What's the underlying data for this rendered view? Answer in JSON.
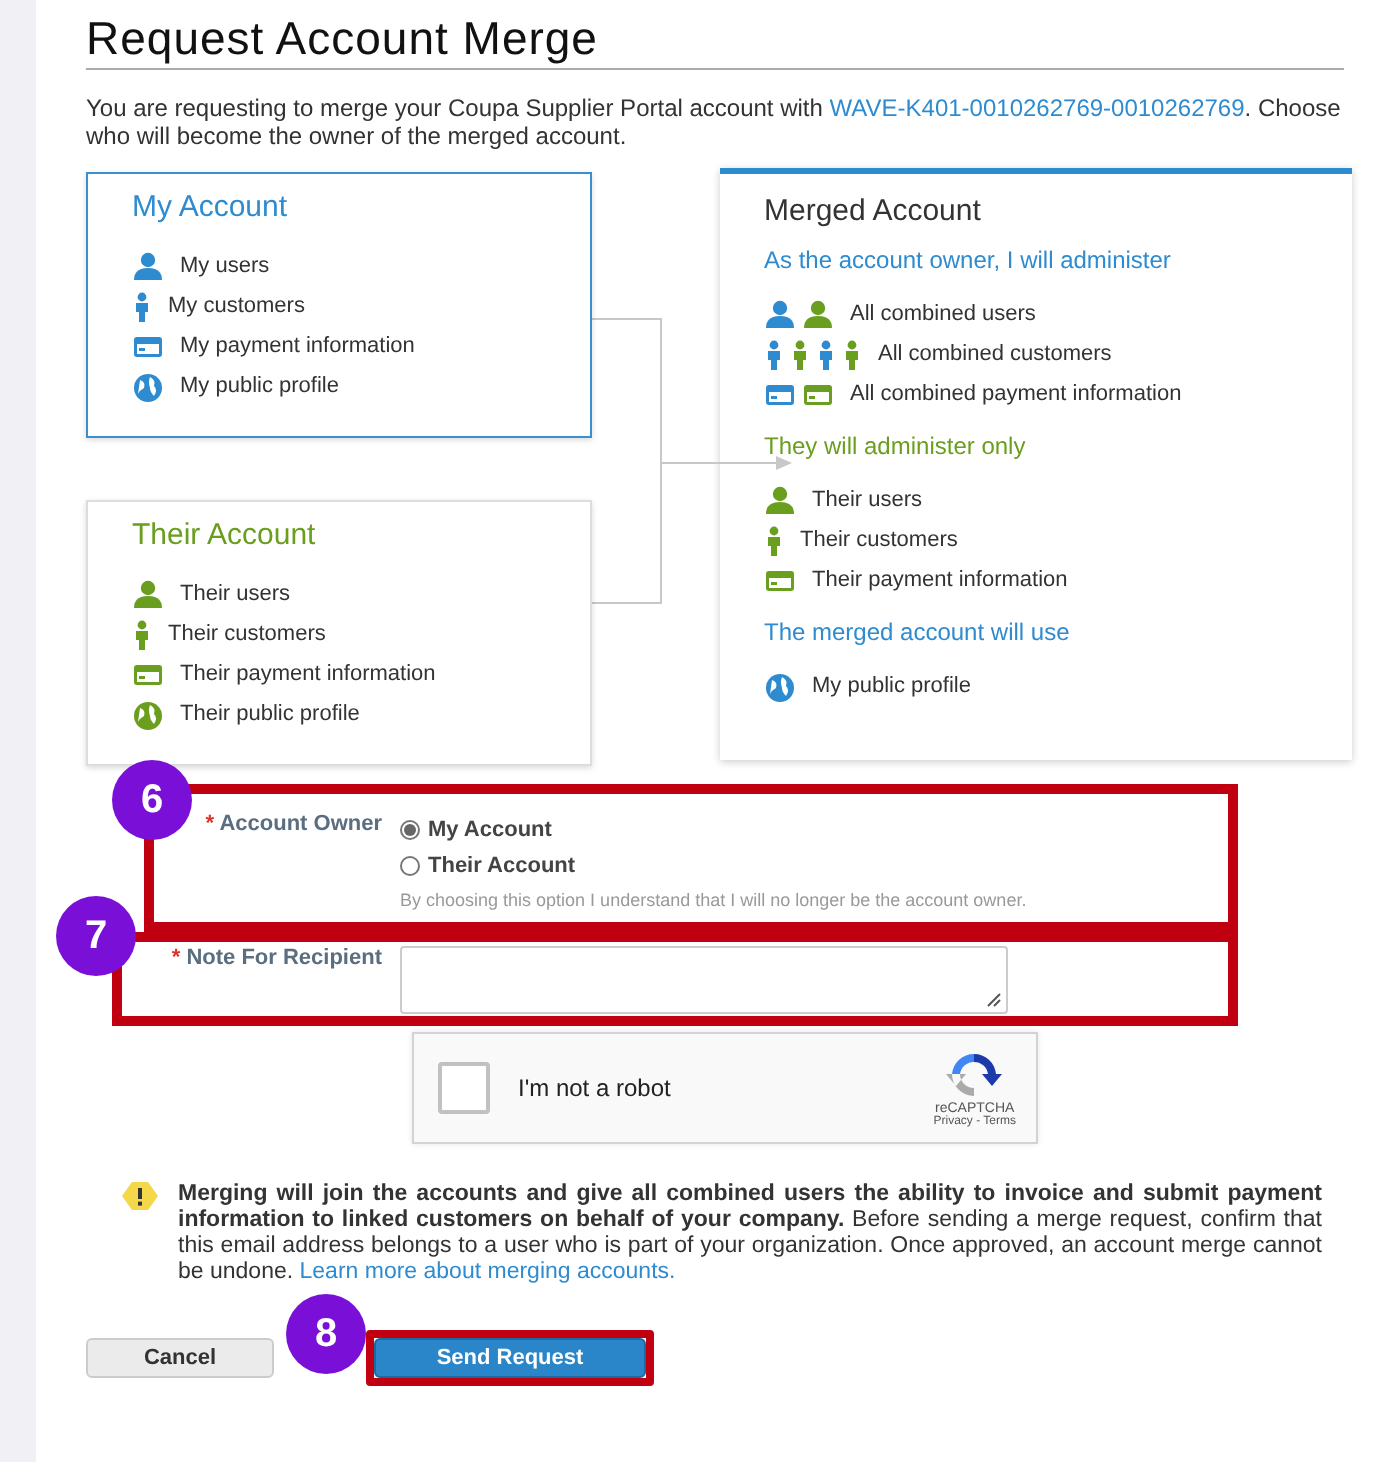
{
  "title": "Request Account Merge",
  "intro": {
    "before": "You are requesting to merge your Coupa Supplier Portal account with ",
    "link": "WAVE-K401-0010262769-0010262769",
    "after": ". Choose who will become the owner of the merged account."
  },
  "my_account": {
    "title": "My Account",
    "items": [
      {
        "kind": "user",
        "color": "#2e8bd0",
        "text": "My users"
      },
      {
        "kind": "customer",
        "color": "#2e8bd0",
        "text": "My customers"
      },
      {
        "kind": "card",
        "color": "#2e8bd0",
        "text": "My payment information"
      },
      {
        "kind": "globe",
        "color": "#2e8bd0",
        "text": "My public profile"
      }
    ]
  },
  "their_account": {
    "title": "Their Account",
    "items": [
      {
        "kind": "user",
        "color": "#6a9e1f",
        "text": "Their users"
      },
      {
        "kind": "customer",
        "color": "#6a9e1f",
        "text": "Their customers"
      },
      {
        "kind": "card",
        "color": "#6a9e1f",
        "text": "Their payment information"
      },
      {
        "kind": "globe",
        "color": "#6a9e1f",
        "text": "Their public profile"
      }
    ]
  },
  "merged_account": {
    "title": "Merged Account",
    "sections": [
      {
        "heading": "As the account owner, I will administer",
        "color": "#2e8bd0",
        "items": [
          {
            "icons": [
              {
                "kind": "user",
                "color": "#2e8bd0"
              },
              {
                "kind": "user",
                "color": "#6a9e1f"
              }
            ],
            "text": "All combined users"
          },
          {
            "icons": [
              {
                "kind": "customer",
                "color": "#2e8bd0"
              },
              {
                "kind": "customer",
                "color": "#6a9e1f"
              },
              {
                "kind": "customer",
                "color": "#2e8bd0"
              },
              {
                "kind": "customer",
                "color": "#6a9e1f"
              }
            ],
            "text": "All combined customers"
          },
          {
            "icons": [
              {
                "kind": "card",
                "color": "#2e8bd0"
              },
              {
                "kind": "card",
                "color": "#6a9e1f"
              }
            ],
            "text": "All combined payment information"
          }
        ]
      },
      {
        "heading": "They will administer only",
        "color": "#6a9e1f",
        "items": [
          {
            "icons": [
              {
                "kind": "user",
                "color": "#6a9e1f"
              }
            ],
            "text": "Their users"
          },
          {
            "icons": [
              {
                "kind": "customer",
                "color": "#6a9e1f"
              }
            ],
            "text": "Their customers"
          },
          {
            "icons": [
              {
                "kind": "card",
                "color": "#6a9e1f"
              }
            ],
            "text": "Their payment information"
          }
        ]
      },
      {
        "heading": "The merged account will use",
        "color": "#2e8bd0",
        "items": [
          {
            "icons": [
              {
                "kind": "globe",
                "color": "#2e8bd0"
              }
            ],
            "text": "My public profile"
          }
        ]
      }
    ]
  },
  "form": [
    {
      "kind": "choice",
      "label": "Account Owner",
      "required": "*",
      "callout": "6",
      "options": [
        {
          "label": "My Account",
          "selected": true
        },
        {
          "label": "Their Account",
          "selected": false
        }
      ],
      "hint": "By choosing this option I understand that I will no longer be the account owner."
    },
    {
      "kind": "note",
      "label": "Note For Recipient",
      "required": "*",
      "callout": "7"
    }
  ],
  "captcha": {
    "label": "I'm not a robot",
    "checked": false,
    "brand": "reCAPTCHA",
    "links": "Privacy - Terms"
  },
  "warning": {
    "text": "**Merging will join the accounts and give all combined users the ability to invoice and submit payment information to linked customers on behalf of your company.** Before sending a merge request, confirm that this email address belongs to a user who is part of your organization. Once approved, an account merge cannot be undone. ",
    "link": "Learn more about merging accounts."
  },
  "buttons": [
    {
      "kind": "secondary",
      "label": "Cancel"
    },
    {
      "kind": "primary",
      "label": "Send Request",
      "callout": "8"
    }
  ]
}
